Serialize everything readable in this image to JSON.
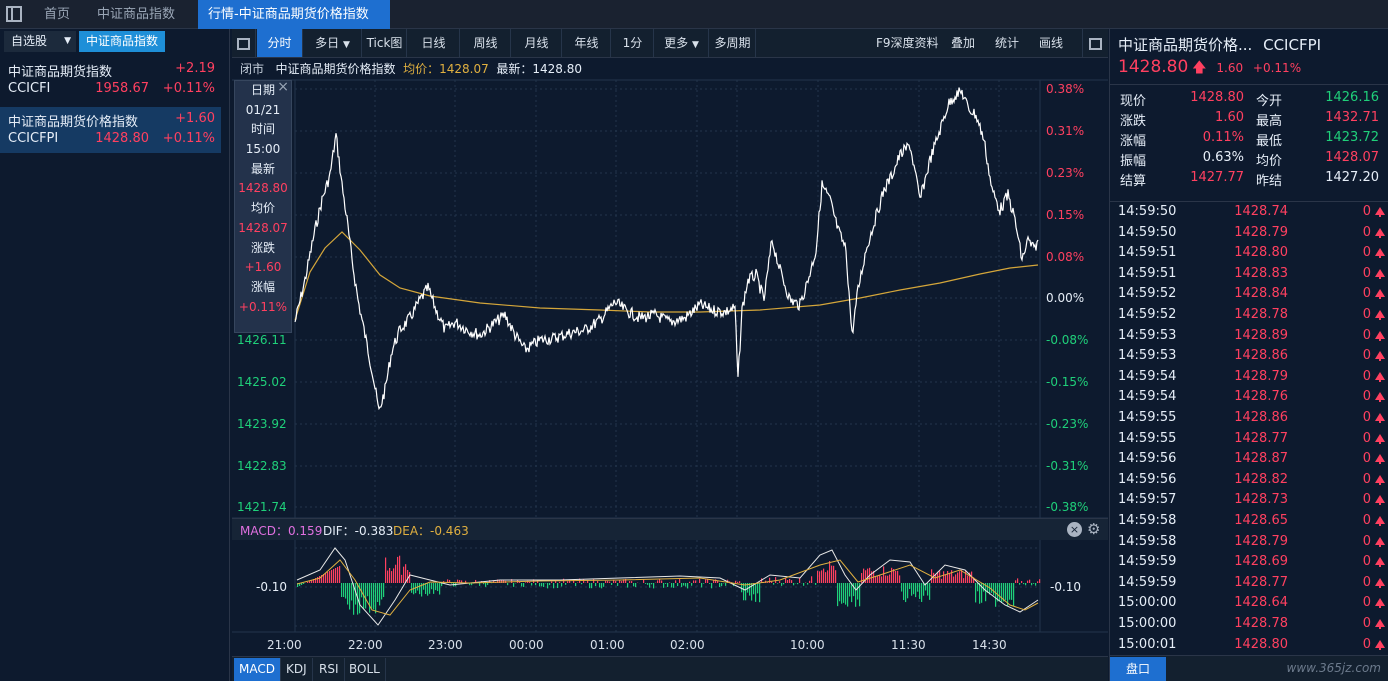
{
  "top_tabs": {
    "home": "首页",
    "index": "中证商品指数",
    "active": "行情-中证商品期货价格指数"
  },
  "left": {
    "tab_watchlist": "自选股",
    "tab_index": "中证商品指数",
    "items": [
      {
        "name": "中证商品期货指数",
        "change": "+2.19",
        "code": "CCICFI",
        "value": "1958.67",
        "pct": "+0.11%"
      },
      {
        "name": "中证商品期货价格指数",
        "change": "+1.60",
        "code": "CCICFPI",
        "value": "1428.80",
        "pct": "+0.11%"
      }
    ]
  },
  "toolbar": {
    "buttons": [
      "分时",
      "多日",
      "Tick图",
      "日线",
      "周线",
      "月线",
      "年线",
      "1分",
      "更多",
      "多周期"
    ],
    "right": [
      "F9深度资料",
      "叠加",
      "统计",
      "画线"
    ]
  },
  "info": {
    "status": "闭市",
    "name": "中证商品期货价格指数",
    "avg_label": "均价：1428.07",
    "latest_label": "最新：1428.80"
  },
  "price_axis": [
    "1426.11",
    "1425.02",
    "1423.92",
    "1422.83",
    "1421.74"
  ],
  "pct_axis": [
    "0.38%",
    "0.31%",
    "0.23%",
    "0.15%",
    "0.08%",
    "0.00%",
    "-0.08%",
    "-0.15%",
    "-0.23%",
    "-0.31%",
    "-0.38%"
  ],
  "tooltip": [
    "日期",
    "01/21",
    "时间",
    "15:00",
    "最新",
    "1428.80",
    "均价",
    "1428.07",
    "涨跌",
    "+1.60",
    "涨幅",
    "+0.11%"
  ],
  "macd": {
    "macd": "MACD：0.159",
    "dif": "DIF：-0.383",
    "dea": "DEA：-0.463",
    "axis_left": "-0.10",
    "axis_right": "-0.10"
  },
  "time_axis": [
    "21:00",
    "22:00",
    "23:00",
    "00:00",
    "01:00",
    "02:00",
    "10:00",
    "11:30",
    "14:30"
  ],
  "bottom_tabs": [
    "MACD",
    "KDJ",
    "RSI",
    "BOLL"
  ],
  "quote": {
    "title": "中证商品期货价格...",
    "code": "CCICFPI",
    "price": "1428.80",
    "change": "1.60",
    "pct": "+0.11%",
    "rows": [
      {
        "k1": "现价",
        "v1": "1428.80",
        "k2": "今开",
        "v2": "1426.16"
      },
      {
        "k1": "涨跌",
        "v1": "1.60",
        "k2": "最高",
        "v2": "1432.71"
      },
      {
        "k1": "涨幅",
        "v1": "0.11%",
        "k2": "最低",
        "v2": "1423.72"
      },
      {
        "k1": "振幅",
        "v1": "0.63%",
        "k2": "均价",
        "v2": "1428.07"
      },
      {
        "k1": "结算",
        "v1": "1427.77",
        "k2": "昨结",
        "v2": "1427.20"
      }
    ],
    "row_colors": [
      {
        "c1": "#ff4060",
        "c2": "#1fd07a"
      },
      {
        "c1": "#ff4060",
        "c2": "#ff4060"
      },
      {
        "c1": "#ff4060",
        "c2": "#1fd07a"
      },
      {
        "c1": "#e6eef8",
        "c2": "#ff4060"
      },
      {
        "c1": "#ff4060",
        "c2": "#e6eef8"
      }
    ]
  },
  "ticks": [
    {
      "time": "14:59:50",
      "price": "1428.74",
      "vol": "0"
    },
    {
      "time": "14:59:50",
      "price": "1428.79",
      "vol": "0"
    },
    {
      "time": "14:59:51",
      "price": "1428.80",
      "vol": "0"
    },
    {
      "time": "14:59:51",
      "price": "1428.83",
      "vol": "0"
    },
    {
      "time": "14:59:52",
      "price": "1428.84",
      "vol": "0"
    },
    {
      "time": "14:59:52",
      "price": "1428.78",
      "vol": "0"
    },
    {
      "time": "14:59:53",
      "price": "1428.89",
      "vol": "0"
    },
    {
      "time": "14:59:53",
      "price": "1428.86",
      "vol": "0"
    },
    {
      "time": "14:59:54",
      "price": "1428.79",
      "vol": "0"
    },
    {
      "time": "14:59:54",
      "price": "1428.76",
      "vol": "0"
    },
    {
      "time": "14:59:55",
      "price": "1428.86",
      "vol": "0"
    },
    {
      "time": "14:59:55",
      "price": "1428.77",
      "vol": "0"
    },
    {
      "time": "14:59:56",
      "price": "1428.87",
      "vol": "0"
    },
    {
      "time": "14:59:56",
      "price": "1428.82",
      "vol": "0"
    },
    {
      "time": "14:59:57",
      "price": "1428.73",
      "vol": "0"
    },
    {
      "time": "14:59:58",
      "price": "1428.65",
      "vol": "0"
    },
    {
      "time": "14:59:58",
      "price": "1428.79",
      "vol": "0"
    },
    {
      "time": "14:59:59",
      "price": "1428.69",
      "vol": "0"
    },
    {
      "time": "14:59:59",
      "price": "1428.77",
      "vol": "0"
    },
    {
      "time": "15:00:00",
      "price": "1428.64",
      "vol": "0"
    },
    {
      "time": "15:00:00",
      "price": "1428.78",
      "vol": "0"
    },
    {
      "time": "15:00:01",
      "price": "1428.80",
      "vol": "0"
    }
  ],
  "panel_button": "盘口",
  "watermark": "www.365jz.com",
  "colors": {
    "up": "#ff4060",
    "down": "#1fd07a",
    "accent": "#1e6fd0",
    "avg_line": "#d4a63a",
    "price_line": "#ffffff"
  }
}
